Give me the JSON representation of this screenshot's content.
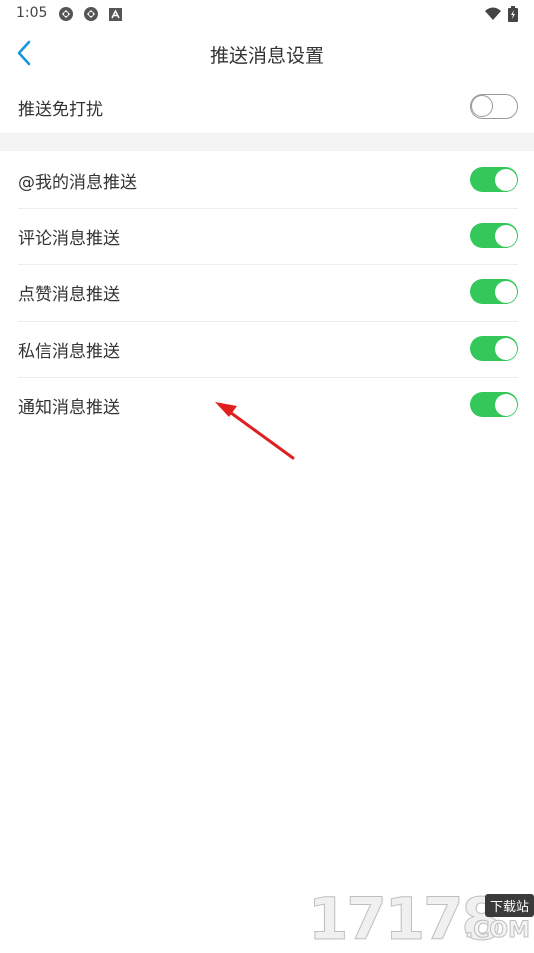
{
  "status_bar": {
    "time": "1:05",
    "left_icons": [
      "sync-icon",
      "sync-icon",
      "a-box-icon"
    ],
    "right_icons": [
      "wifi-icon",
      "battery-icon"
    ]
  },
  "header": {
    "title": "推送消息设置",
    "back_icon": "chevron-left-icon",
    "accent_color": "#1296db"
  },
  "settings": {
    "dnd": {
      "label": "推送免打扰",
      "enabled": false
    },
    "items": [
      {
        "label": "@我的消息推送",
        "enabled": true
      },
      {
        "label": "评论消息推送",
        "enabled": true
      },
      {
        "label": "点赞消息推送",
        "enabled": true
      },
      {
        "label": "私信消息推送",
        "enabled": true
      },
      {
        "label": "通知消息推送",
        "enabled": true
      }
    ]
  },
  "colors": {
    "toggle_on": "#34c759",
    "toggle_off_border": "#9a9a9a",
    "annotation_arrow": "#e02020"
  },
  "watermark": {
    "digits": "17178",
    "tag": "下载站",
    "suffix": ".COM"
  }
}
